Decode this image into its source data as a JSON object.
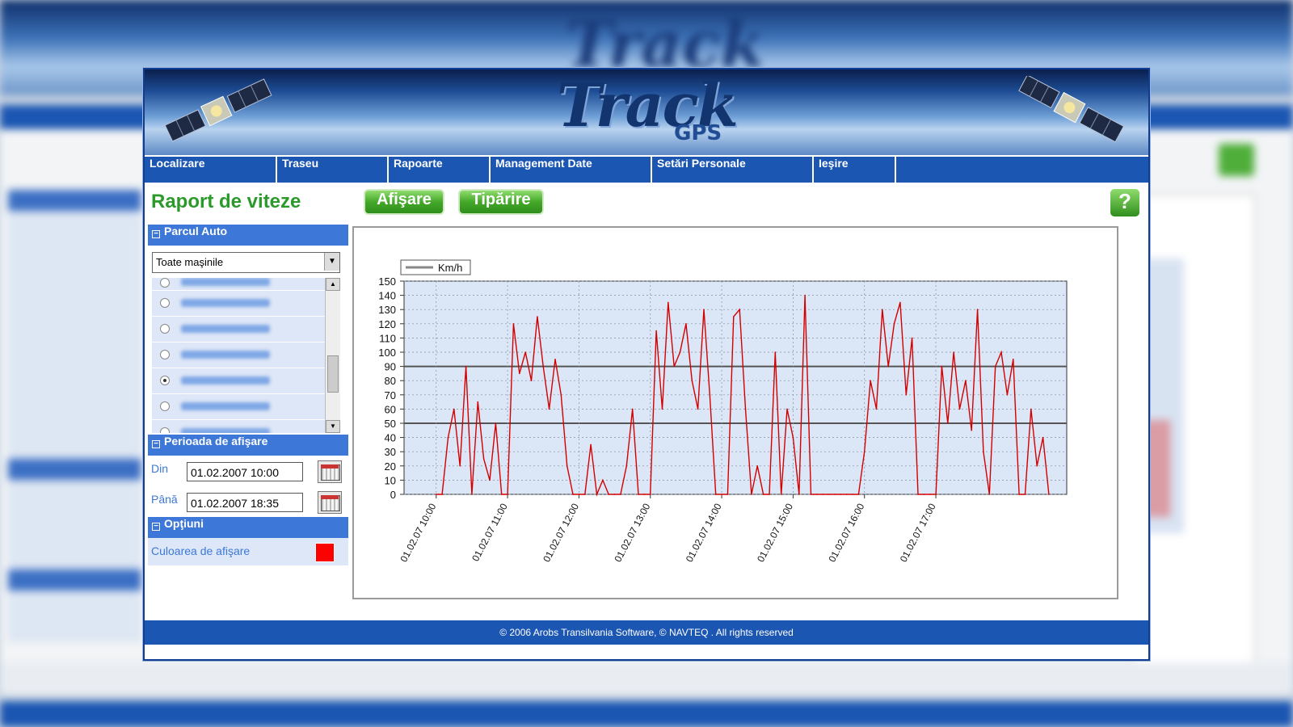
{
  "nav": {
    "items": [
      "Localizare",
      "Traseu",
      "Rapoarte",
      "Management Date",
      "Setări Personale",
      "Ieşire"
    ]
  },
  "page": {
    "title": "Raport de viteze",
    "show_button": "Afişare",
    "print_button": "Tipărire",
    "help_label": "?"
  },
  "sidebar": {
    "fleet_header": "Parcul Auto",
    "vehicle_select": "Toate maşinile",
    "vehicles_selected_index": 4,
    "period_header": "Perioada de afişare",
    "from_label": "Din",
    "from_value": "01.02.2007 10:00",
    "to_label": "Până",
    "to_value": "01.02.2007 18:35",
    "options_header": "Opţiuni",
    "color_label": "Culoarea de afişare",
    "color_value": "#ff0000"
  },
  "footer": "© 2006 Arobs Transilvania Software, © NAVTEQ . All rights reserved",
  "chart_data": {
    "type": "line",
    "legend": [
      "Km/h"
    ],
    "legend_placement": "top-left",
    "ylim": [
      0,
      150
    ],
    "yticks": [
      0,
      10,
      20,
      30,
      40,
      50,
      60,
      70,
      80,
      90,
      100,
      110,
      120,
      130,
      140,
      150
    ],
    "x_tick_labels": [
      "01.02.07 10:00",
      "01.02.07 11:00",
      "01.02.07 12:00",
      "01.02.07 13:00",
      "01.02.07 14:00",
      "01.02.07 15:00",
      "01.02.07 16:00",
      "01.02.07 17:00"
    ],
    "reference_lines": [
      50,
      90
    ],
    "grid": true,
    "series": [
      {
        "name": "Km/h",
        "color": "#d40000",
        "x": [
          "10:00",
          "10:05",
          "10:10",
          "10:15",
          "10:20",
          "10:25",
          "10:30",
          "10:35",
          "10:40",
          "10:45",
          "10:50",
          "10:55",
          "11:00",
          "11:05",
          "11:10",
          "11:15",
          "11:20",
          "11:25",
          "11:30",
          "11:35",
          "11:40",
          "11:45",
          "11:50",
          "11:55",
          "12:00",
          "12:05",
          "12:10",
          "12:15",
          "12:20",
          "12:25",
          "12:30",
          "12:35",
          "12:40",
          "12:45",
          "12:50",
          "12:55",
          "13:00",
          "13:05",
          "13:10",
          "13:15",
          "13:20",
          "13:25",
          "13:30",
          "13:35",
          "13:40",
          "13:45",
          "13:50",
          "13:55",
          "14:00",
          "14:05",
          "14:10",
          "14:15",
          "14:20",
          "14:25",
          "14:30",
          "14:35",
          "14:40",
          "14:45",
          "14:50",
          "14:55",
          "15:00",
          "15:05",
          "15:10",
          "15:15",
          "15:20",
          "15:25",
          "15:30",
          "15:35",
          "15:40",
          "15:45",
          "15:50",
          "15:55",
          "16:00",
          "16:05",
          "16:10",
          "16:15",
          "16:20",
          "16:25",
          "16:30",
          "16:35",
          "16:40",
          "16:45",
          "16:50",
          "16:55",
          "17:00",
          "17:05",
          "17:10",
          "17:15",
          "17:20",
          "17:25",
          "17:30",
          "17:35",
          "17:40",
          "17:45",
          "17:50",
          "17:55",
          "18:00",
          "18:05",
          "18:10",
          "18:15",
          "18:20",
          "18:25",
          "18:30",
          "18:35"
        ],
        "values": [
          0,
          0,
          40,
          60,
          20,
          90,
          0,
          65,
          25,
          10,
          50,
          0,
          0,
          120,
          85,
          100,
          80,
          125,
          90,
          60,
          95,
          70,
          20,
          0,
          0,
          0,
          35,
          0,
          10,
          0,
          0,
          0,
          20,
          60,
          0,
          0,
          0,
          115,
          60,
          135,
          90,
          100,
          120,
          80,
          60,
          130,
          70,
          0,
          0,
          0,
          125,
          130,
          60,
          0,
          20,
          0,
          0,
          100,
          0,
          60,
          40,
          0,
          140,
          0,
          0,
          0,
          0,
          0,
          0,
          0,
          0,
          0,
          30,
          80,
          60,
          130,
          90,
          120,
          135,
          70,
          110,
          0,
          0,
          0,
          0,
          90,
          50,
          100,
          60,
          80,
          45,
          130,
          30,
          0,
          90,
          100,
          70,
          95,
          0,
          0,
          60,
          20,
          40,
          0
        ]
      }
    ]
  }
}
